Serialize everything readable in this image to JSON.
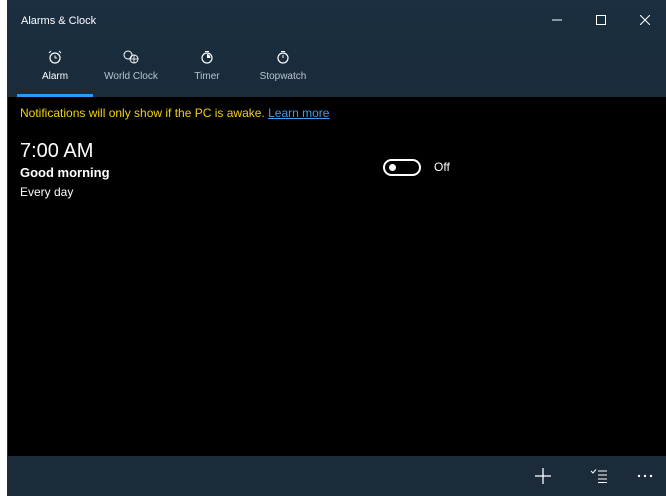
{
  "window": {
    "title": "Alarms & Clock"
  },
  "tabs": [
    {
      "label": "Alarm",
      "icon": "alarm-icon",
      "active": true
    },
    {
      "label": "World Clock",
      "icon": "globe-clock-icon",
      "active": false
    },
    {
      "label": "Timer",
      "icon": "timer-icon",
      "active": false
    },
    {
      "label": "Stopwatch",
      "icon": "stopwatch-icon",
      "active": false
    }
  ],
  "notice": {
    "text": "Notifications will only show if the PC is awake.",
    "link": "Learn more"
  },
  "alarm": {
    "time": "7:00 AM",
    "name": "Good morning",
    "repeat": "Every day",
    "toggle_state": "Off"
  },
  "commands": {
    "add": "add-icon",
    "select": "select-icon",
    "more": "more-icon"
  },
  "colors": {
    "header": "#1b2f40",
    "accent": "#2b9af3",
    "notice": "#f2d20a",
    "link": "#3c9cf0"
  }
}
